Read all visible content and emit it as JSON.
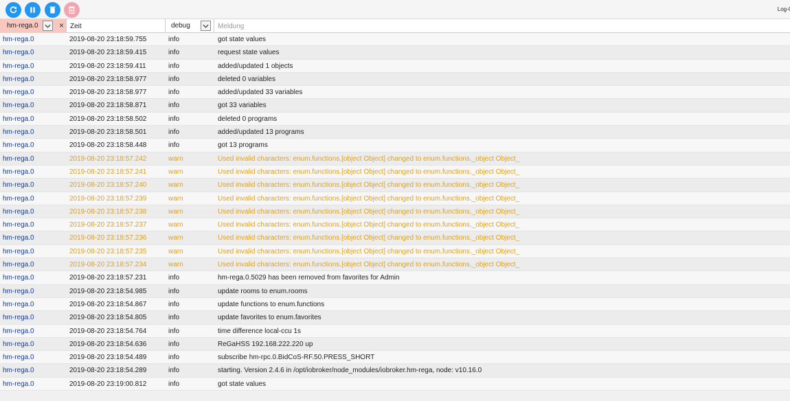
{
  "toolbar": {
    "title": "Log-G",
    "buttons": [
      {
        "name": "refresh",
        "icon": "refresh-icon"
      },
      {
        "name": "pause",
        "icon": "pause-icon"
      },
      {
        "name": "clear",
        "icon": "trash-icon"
      },
      {
        "name": "delete",
        "icon": "delete-icon",
        "disabled": true
      }
    ]
  },
  "filters": {
    "source_value": "hm-rega.0",
    "clear_symbol": "×",
    "time_value": "Zeit",
    "level_value": "debug",
    "message_placeholder": "Meldung"
  },
  "colors": {
    "accent": "#2196f3",
    "warn": "#e0a020",
    "source": "#1a3d9c",
    "source_filter_bg": "#f8c8c0"
  },
  "log": [
    {
      "source": "hm-rega.0",
      "time": "2019-08-20 23:18:59.755",
      "level": "info",
      "message": "got state values"
    },
    {
      "source": "hm-rega.0",
      "time": "2019-08-20 23:18:59.415",
      "level": "info",
      "message": "request state values"
    },
    {
      "source": "hm-rega.0",
      "time": "2019-08-20 23:18:59.411",
      "level": "info",
      "message": "added/updated 1 objects"
    },
    {
      "source": "hm-rega.0",
      "time": "2019-08-20 23:18:58.977",
      "level": "info",
      "message": "deleted 0 variables"
    },
    {
      "source": "hm-rega.0",
      "time": "2019-08-20 23:18:58.977",
      "level": "info",
      "message": "added/updated 33 variables"
    },
    {
      "source": "hm-rega.0",
      "time": "2019-08-20 23:18:58.871",
      "level": "info",
      "message": "got 33 variables"
    },
    {
      "source": "hm-rega.0",
      "time": "2019-08-20 23:18:58.502",
      "level": "info",
      "message": "deleted 0 programs"
    },
    {
      "source": "hm-rega.0",
      "time": "2019-08-20 23:18:58.501",
      "level": "info",
      "message": "added/updated 13 programs"
    },
    {
      "source": "hm-rega.0",
      "time": "2019-08-20 23:18:58.448",
      "level": "info",
      "message": "got 13 programs"
    },
    {
      "source": "hm-rega.0",
      "time": "2019-08-20 23:18:57.242",
      "level": "warn",
      "message": "Used invalid characters: enum.functions.[object Object] changed to enum.functions._object Object_"
    },
    {
      "source": "hm-rega.0",
      "time": "2019-08-20 23:18:57.241",
      "level": "warn",
      "message": "Used invalid characters: enum.functions.[object Object] changed to enum.functions._object Object_"
    },
    {
      "source": "hm-rega.0",
      "time": "2019-08-20 23:18:57.240",
      "level": "warn",
      "message": "Used invalid characters: enum.functions.[object Object] changed to enum.functions._object Object_"
    },
    {
      "source": "hm-rega.0",
      "time": "2019-08-20 23:18:57.239",
      "level": "warn",
      "message": "Used invalid characters: enum.functions.[object Object] changed to enum.functions._object Object_"
    },
    {
      "source": "hm-rega.0",
      "time": "2019-08-20 23:18:57.238",
      "level": "warn",
      "message": "Used invalid characters: enum.functions.[object Object] changed to enum.functions._object Object_"
    },
    {
      "source": "hm-rega.0",
      "time": "2019-08-20 23:18:57.237",
      "level": "warn",
      "message": "Used invalid characters: enum.functions.[object Object] changed to enum.functions._object Object_"
    },
    {
      "source": "hm-rega.0",
      "time": "2019-08-20 23:18:57.236",
      "level": "warn",
      "message": "Used invalid characters: enum.functions.[object Object] changed to enum.functions._object Object_"
    },
    {
      "source": "hm-rega.0",
      "time": "2019-08-20 23:18:57.235",
      "level": "warn",
      "message": "Used invalid characters: enum.functions.[object Object] changed to enum.functions._object Object_"
    },
    {
      "source": "hm-rega.0",
      "time": "2019-08-20 23:18:57.234",
      "level": "warn",
      "message": "Used invalid characters: enum.functions.[object Object] changed to enum.functions._object Object_"
    },
    {
      "source": "hm-rega.0",
      "time": "2019-08-20 23:18:57.231",
      "level": "info",
      "message": "hm-rega.0.5029 has been removed from favorites for Admin"
    },
    {
      "source": "hm-rega.0",
      "time": "2019-08-20 23:18:54.985",
      "level": "info",
      "message": "update rooms to enum.rooms"
    },
    {
      "source": "hm-rega.0",
      "time": "2019-08-20 23:18:54.867",
      "level": "info",
      "message": "update functions to enum.functions"
    },
    {
      "source": "hm-rega.0",
      "time": "2019-08-20 23:18:54.805",
      "level": "info",
      "message": "update favorites to enum.favorites"
    },
    {
      "source": "hm-rega.0",
      "time": "2019-08-20 23:18:54.764",
      "level": "info",
      "message": "time difference local-ccu 1s"
    },
    {
      "source": "hm-rega.0",
      "time": "2019-08-20 23:18:54.636",
      "level": "info",
      "message": "ReGaHSS 192.168.222.220 up"
    },
    {
      "source": "hm-rega.0",
      "time": "2019-08-20 23:18:54.489",
      "level": "info",
      "message": "subscribe hm-rpc.0.BidCoS-RF.50.PRESS_SHORT"
    },
    {
      "source": "hm-rega.0",
      "time": "2019-08-20 23:18:54.289",
      "level": "info",
      "message": "starting. Version 2.4.6 in /opt/iobroker/node_modules/iobroker.hm-rega, node: v10.16.0"
    },
    {
      "source": "hm-rega.0",
      "time": "2019-08-20 23:19:00.812",
      "level": "info",
      "message": "got state values"
    }
  ]
}
